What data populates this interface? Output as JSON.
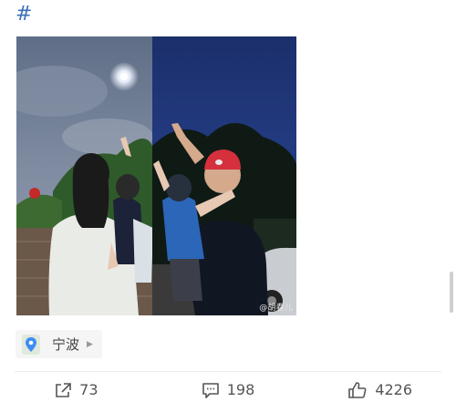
{
  "post": {
    "hashtag": "#",
    "watermark": "@胡春儿",
    "location": {
      "label": "宁波",
      "icon": "location-pin-icon",
      "accent": "#3d8df5"
    }
  },
  "actions": {
    "repost": {
      "count": "73",
      "icon": "share-icon"
    },
    "comment": {
      "count": "198",
      "icon": "comment-icon"
    },
    "like": {
      "count": "4226",
      "icon": "thumbs-up-icon"
    }
  }
}
